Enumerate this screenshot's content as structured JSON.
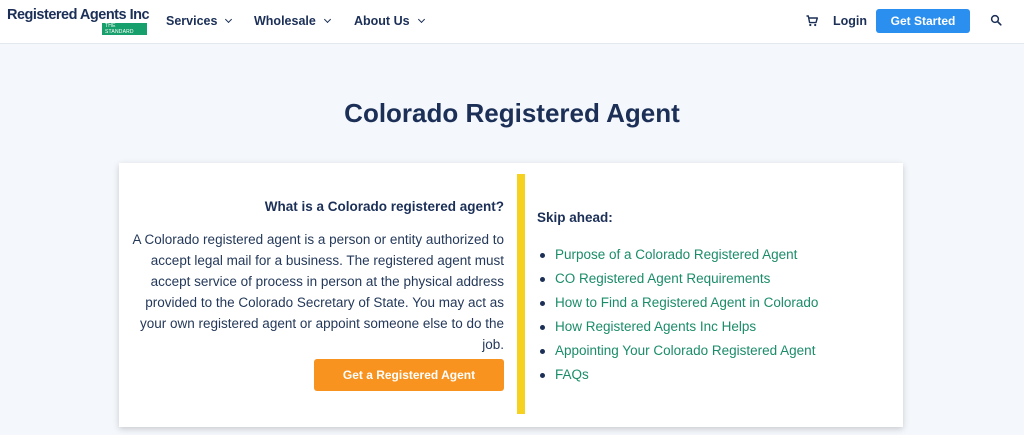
{
  "nav": {
    "logo_main": "Registered Agents Inc",
    "logo_sub": "THE STANDARD",
    "menu": [
      {
        "label": "Services"
      },
      {
        "label": "Wholesale"
      },
      {
        "label": "About Us"
      }
    ],
    "login_label": "Login",
    "cta_label": "Get Started"
  },
  "page": {
    "title": "Colorado Registered Agent"
  },
  "intro": {
    "question": "What is a Colorado registered agent?",
    "body": "A Colorado registered agent is a person or entity authorized to accept legal mail for a business. The registered agent must accept service of process in person at the physical address provided to the Colorado Secretary of State. You may act as your own registered agent or appoint someone else to do the job.",
    "button_label": "Get a Registered Agent"
  },
  "skip": {
    "heading": "Skip ahead:",
    "links": [
      "Purpose of a Colorado Registered Agent",
      "CO Registered Agent Requirements",
      "How to Find a Registered Agent in Colorado",
      "How Registered Agents Inc Helps",
      "Appointing Your Colorado Registered Agent",
      "FAQs"
    ]
  },
  "colors": {
    "navy": "#1b2f57",
    "primary_blue": "#2b8ff0",
    "orange": "#f7931e",
    "green_link": "#1b8c69",
    "divider_yellow": "#f6d11f"
  },
  "icons": {
    "cart": "shopping-cart-icon",
    "search": "search-icon",
    "chevron": "chevron-down-icon"
  }
}
